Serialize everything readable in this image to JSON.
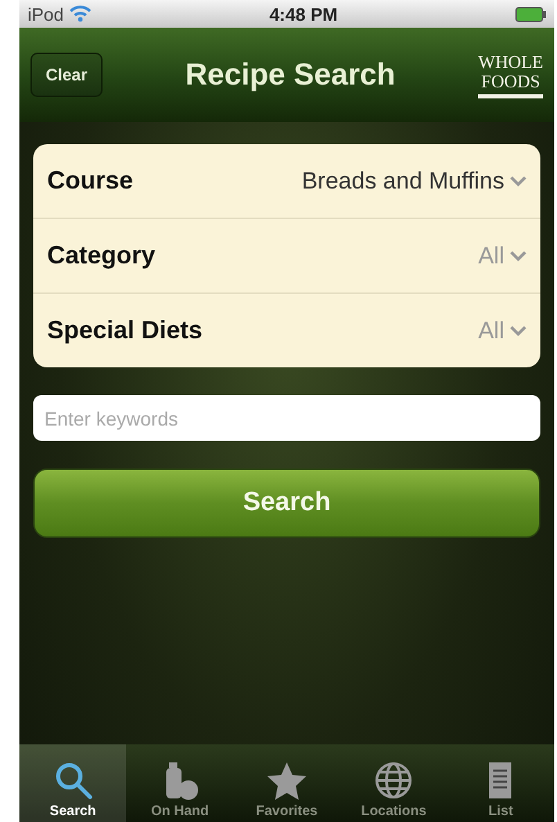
{
  "status_bar": {
    "carrier": "iPod",
    "time": "4:48 PM"
  },
  "nav_bar": {
    "left_button": "Clear",
    "title": "Recipe Search",
    "logo": [
      "WHOLE",
      "FOODS"
    ]
  },
  "filters": [
    {
      "label": "Course",
      "value": "Breads and Muffins",
      "default": false
    },
    {
      "label": "Category",
      "value": "All",
      "default": true
    },
    {
      "label": "Special Diets",
      "value": "All",
      "default": true
    }
  ],
  "search": {
    "placeholder": "Enter keywords",
    "button": "Search"
  },
  "tab_bar": [
    {
      "label": "Search",
      "selected": true
    },
    {
      "label": "On Hand",
      "selected": false
    },
    {
      "label": "Favorites",
      "selected": false
    },
    {
      "label": "Locations",
      "selected": false
    },
    {
      "label": "List",
      "selected": false
    }
  ]
}
